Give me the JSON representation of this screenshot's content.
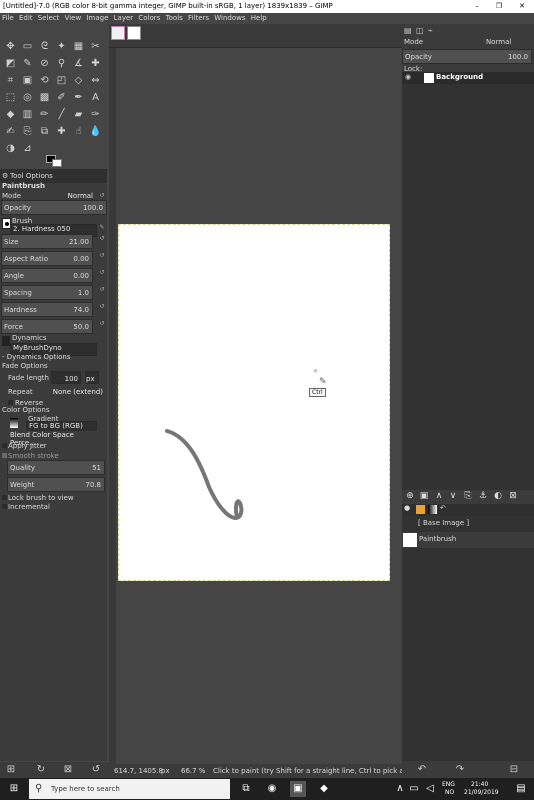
{
  "window": {
    "title": "[Untitled]-7.0 (RGB color 8-bit gamma integer, GIMP built-in sRGB, 1 layer) 1839x1839 – GIMP",
    "controls": [
      "–",
      "❐",
      "✕"
    ]
  },
  "menu": [
    "File",
    "Edit",
    "Select",
    "View",
    "Image",
    "Layer",
    "Colors",
    "Tools",
    "Filters",
    "Windows",
    "Help"
  ],
  "tool_options": {
    "tab_label": "Tool Options",
    "tool_name": "Paintbrush",
    "mode_label": "Mode",
    "mode_value": "Normal",
    "opacity_label": "Opacity",
    "opacity_value": "100.0",
    "brush_label": "Brush",
    "brush_value": "2. Hardness 050",
    "size_label": "Size",
    "size_value": "21.00",
    "aspect_label": "Aspect Ratio",
    "aspect_value": "0.00",
    "angle_label": "Angle",
    "angle_value": "0.00",
    "spacing_label": "Spacing",
    "spacing_value": "1.0",
    "hardness_label": "Hardness",
    "hardness_value": "74.0",
    "force_label": "Force",
    "force_value": "50.0",
    "dynamics_label": "Dynamics",
    "dynamics_value": "MyBrushDyno",
    "dynamics_options": "- Dynamics Options",
    "fade_options": "Fade Options",
    "fade_length_label": "Fade length",
    "fade_length_value": "100",
    "fade_unit": "px",
    "repeat_label": "Repeat",
    "repeat_value": "None (extend)",
    "reverse_label": "Reverse",
    "color_options": "Color Options",
    "gradient_label": "Gradient",
    "gradient_value": "FG to BG (RGB)",
    "blend_space": "Blend Color Space Perce...",
    "apply_jitter": "Apply Jitter",
    "smooth_stroke": "Smooth stroke",
    "quality_label": "Quality",
    "quality_value": "51",
    "weight_label": "Weight",
    "weight_value": "70.8",
    "lock_brush": "Lock brush to view",
    "incremental": "Incremental"
  },
  "canvas": {
    "tooltip": "Ctrl",
    "stroke_color": "#767676"
  },
  "status": {
    "coords": "614.7, 1405.8",
    "unit": "px",
    "zoom": "66.7 %",
    "message": "Click to paint (try Shift for a straight line, Ctrl to pick a col..."
  },
  "layers": {
    "mode_label": "Mode",
    "mode_value": "Normal",
    "opacity_label": "Opacity",
    "opacity_value": "100.0",
    "lock_label": "Lock:",
    "layer_name": "Background"
  },
  "undo_history": {
    "base_image": "[ Base Image ]",
    "step_1": "Paintbrush"
  },
  "taskbar": {
    "search_placeholder": "Type here to search",
    "lang_top": "ENG",
    "lang_bottom": "NO",
    "time": "21:40",
    "date": "21/09/2019"
  }
}
